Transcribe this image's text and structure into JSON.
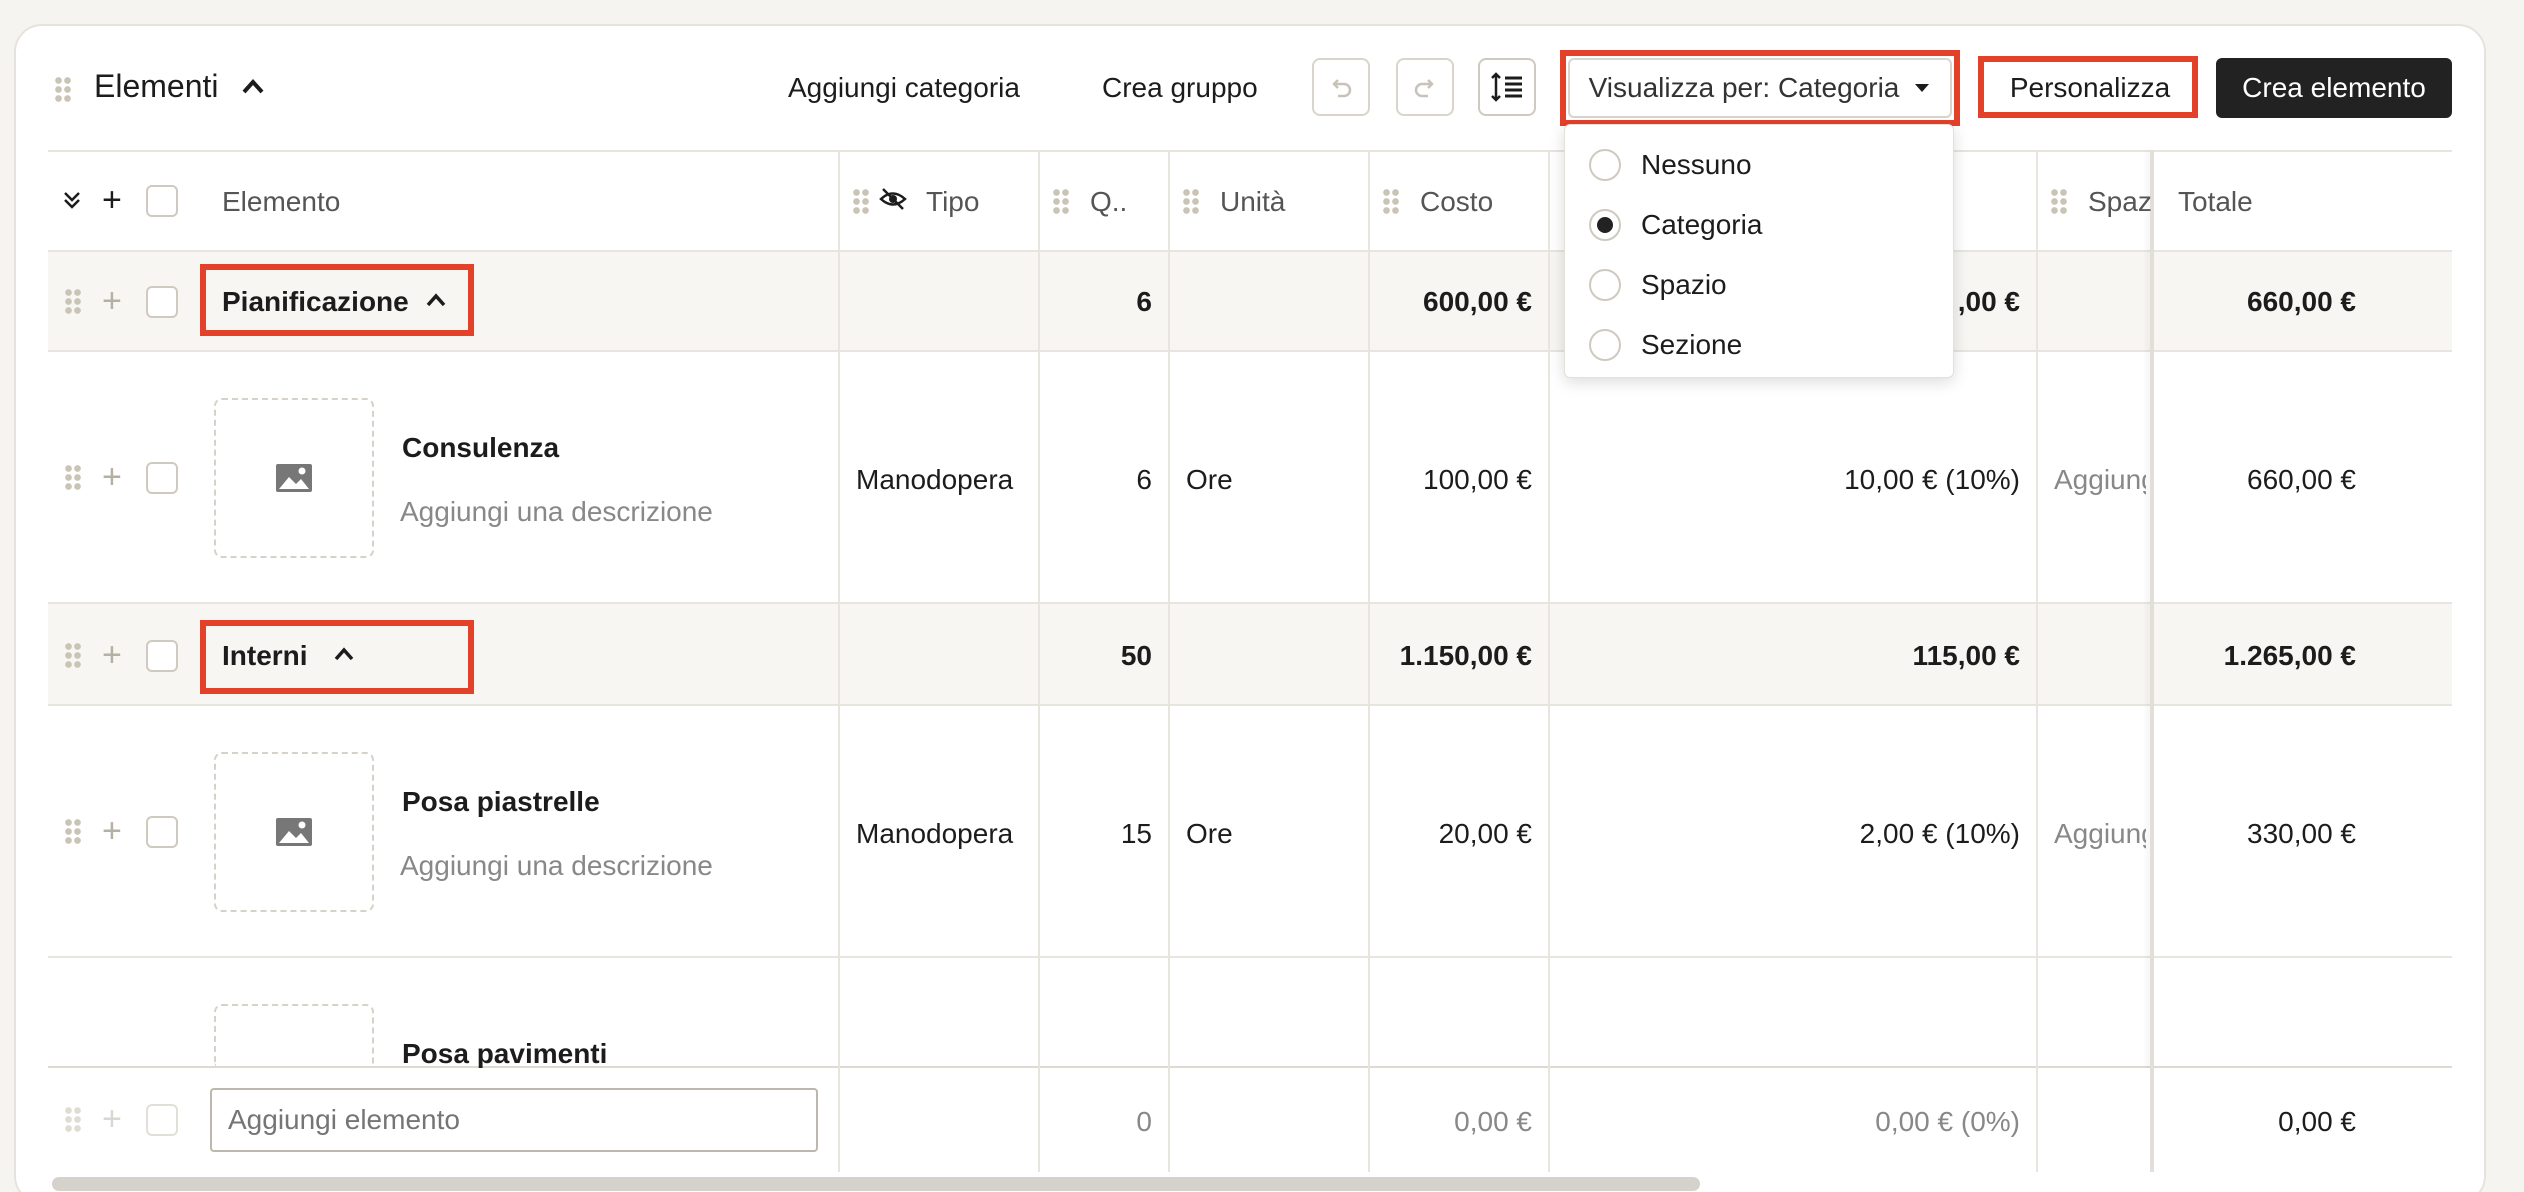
{
  "toolbar": {
    "title": "Elementi",
    "add_category": "Aggiungi categoria",
    "create_group": "Crea gruppo",
    "view_by": "Visualizza per: Categoria",
    "customize": "Personalizza",
    "create_element": "Crea elemento"
  },
  "dropdown": {
    "options": [
      {
        "label": "Nessuno",
        "selected": false
      },
      {
        "label": "Categoria",
        "selected": true
      },
      {
        "label": "Spazio",
        "selected": false
      },
      {
        "label": "Sezione",
        "selected": false
      }
    ]
  },
  "columns": {
    "element": "Elemento",
    "type": "Tipo",
    "qty": "Q..",
    "unit": "Unità",
    "cost": "Costo",
    "space": "Spaz",
    "total": "Totale"
  },
  "groups": [
    {
      "name": "Pianificazione",
      "qty": "6",
      "cost": "600,00 €",
      "markup": ",00 €",
      "total": "660,00 €",
      "items": [
        {
          "name": "Consulenza",
          "desc": "Aggiungi una descrizione",
          "type": "Manodopera",
          "qty": "6",
          "unit": "Ore",
          "cost": "100,00 €",
          "markup": "10,00 € (10%)",
          "space": "Aggiung",
          "total": "660,00 €"
        }
      ]
    },
    {
      "name": "Interni",
      "qty": "50",
      "cost": "1.150,00 €",
      "markup": "115,00 €",
      "total": "1.265,00 €",
      "items": [
        {
          "name": "Posa piastrelle",
          "desc": "Aggiungi una descrizione",
          "type": "Manodopera",
          "qty": "15",
          "unit": "Ore",
          "cost": "20,00 €",
          "markup": "2,00 € (10%)",
          "space": "Aggiung",
          "total": "330,00 €"
        },
        {
          "name": "Posa pavimenti"
        }
      ]
    }
  ],
  "footer": {
    "placeholder": "Aggiungi elemento",
    "qty": "0",
    "cost": "0,00 €",
    "markup": "0,00 € (0%)",
    "total": "0,00 €"
  },
  "colors": {
    "highlight": "#e4412b",
    "primary_button": "#222222",
    "row_band": "#f7f6f2"
  }
}
